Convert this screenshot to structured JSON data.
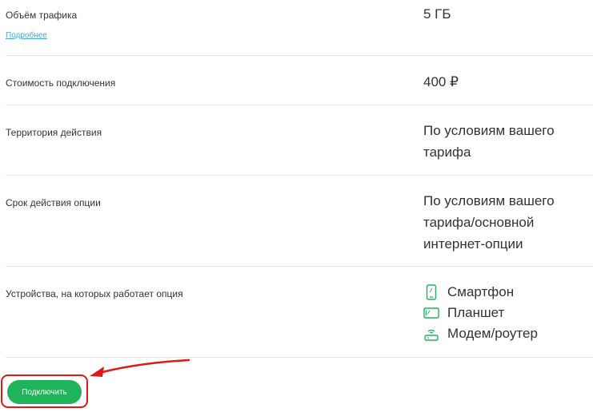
{
  "rows": [
    {
      "label": "Объём трафика",
      "value": "5 ГБ",
      "link": "Подробнее"
    },
    {
      "label": "Стоимость подключения",
      "value": "400 ₽"
    },
    {
      "label": "Территория действия",
      "value": "По условиям вашего тарифа"
    },
    {
      "label": "Срок действия опции",
      "value": "По условиям вашего тарифа/основной интернет-опции"
    },
    {
      "label": "Устройства, на которых работает опция"
    }
  ],
  "devices": [
    {
      "label": "Смартфон",
      "icon": "smartphone-icon"
    },
    {
      "label": "Планшет",
      "icon": "tablet-icon"
    },
    {
      "label": "Модем/роутер",
      "icon": "modem-router-icon"
    }
  ],
  "connect_button": {
    "label": "Подключить"
  },
  "colors": {
    "accent": "#1fb35a",
    "link": "#4aa8d8",
    "annotation": "#e01818",
    "divider": "#e3e3e3"
  }
}
